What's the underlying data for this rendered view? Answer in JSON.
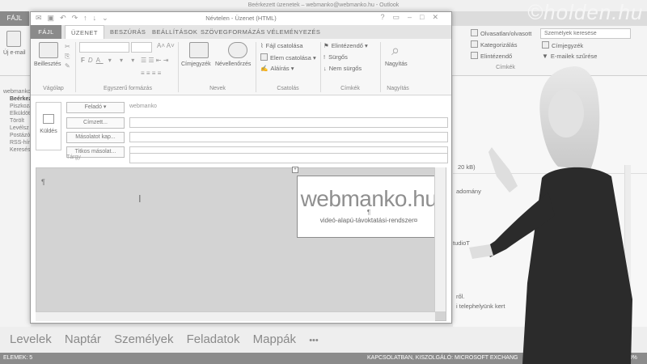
{
  "outlook": {
    "title": "Beérkezett üzenetek – webmanko@webmanko.hu - Outlook",
    "file_tab": "FÁJL",
    "ribbon": {
      "new_label": "Új e-mail",
      "readers_label": "Olvasatlan/olvasott",
      "categorize_label": "Kategorizálás",
      "followup_label": "Elintézendő",
      "search_people_placeholder": "Személyek keresése",
      "addressbook_label": "Címjegyzék",
      "filter_label": "E-mailek szűrése",
      "tags_group": "Címkék"
    },
    "folders": [
      "webmanko",
      "Beérkez",
      "Piszkozat",
      "Elküldött",
      "Törölt",
      "Levélsz",
      "Postázó",
      "RSS-hír",
      "Keresés"
    ],
    "bg_fragments": [
      "20 kB)",
      "adomány",
      "tudioT",
      "ről.",
      "i telephelyünk kert"
    ],
    "bottom_nav": [
      "Levelek",
      "Naptár",
      "Személyek",
      "Feladatok",
      "Mappák",
      "•••"
    ],
    "status_left": "ELEMEK: 5",
    "status_right": "KAPCSOLATBAN, KISZOLGÁLÓ: MICROSOFT EXCHANG",
    "zoom": "100%"
  },
  "message": {
    "title": "Névtelen - Üzenet (HTML)",
    "tabs": [
      "FÁJL",
      "ÜZENET",
      "BESZÚRÁS",
      "BEÁLLÍTÁSOK",
      "SZÖVEGFORMÁZÁS",
      "VÉLEMÉNYEZÉS"
    ],
    "clipboard": {
      "paste": "Beillesztés",
      "group": "Vágólap"
    },
    "basic_text": {
      "group": "Egyszerű formázás",
      "buttons": [
        "F",
        "D",
        "A"
      ]
    },
    "names": {
      "addressbook": "Címjegyzék",
      "check": "Névellenőrzés",
      "group": "Nevek"
    },
    "include": {
      "attach_file": "Fájl csatolása",
      "attach_item": "Elem csatolása",
      "signature": "Aláírás",
      "group": "Csatolás"
    },
    "tags": {
      "followup": "Elintézendő",
      "high": "Sürgős",
      "low": "Nem sürgős",
      "group": "Címkék"
    },
    "zoom": {
      "label": "Nagyítás",
      "group": "Nagyítás"
    },
    "send": "Küldés",
    "from_button": "Feladó",
    "from_value": "webmanko",
    "to_button": "Címzett...",
    "cc_button": "Másolatot kap...",
    "bcc_button": "Titkos másolat...",
    "subject_label": "Tárgy",
    "pilcrow": "¶",
    "signature_logo": "webmanko.hu",
    "signature_pilcrow": "¶",
    "signature_tagline": "videó-alapú-távoktatási-rendszer¤"
  },
  "watermark": "©holden.hu"
}
